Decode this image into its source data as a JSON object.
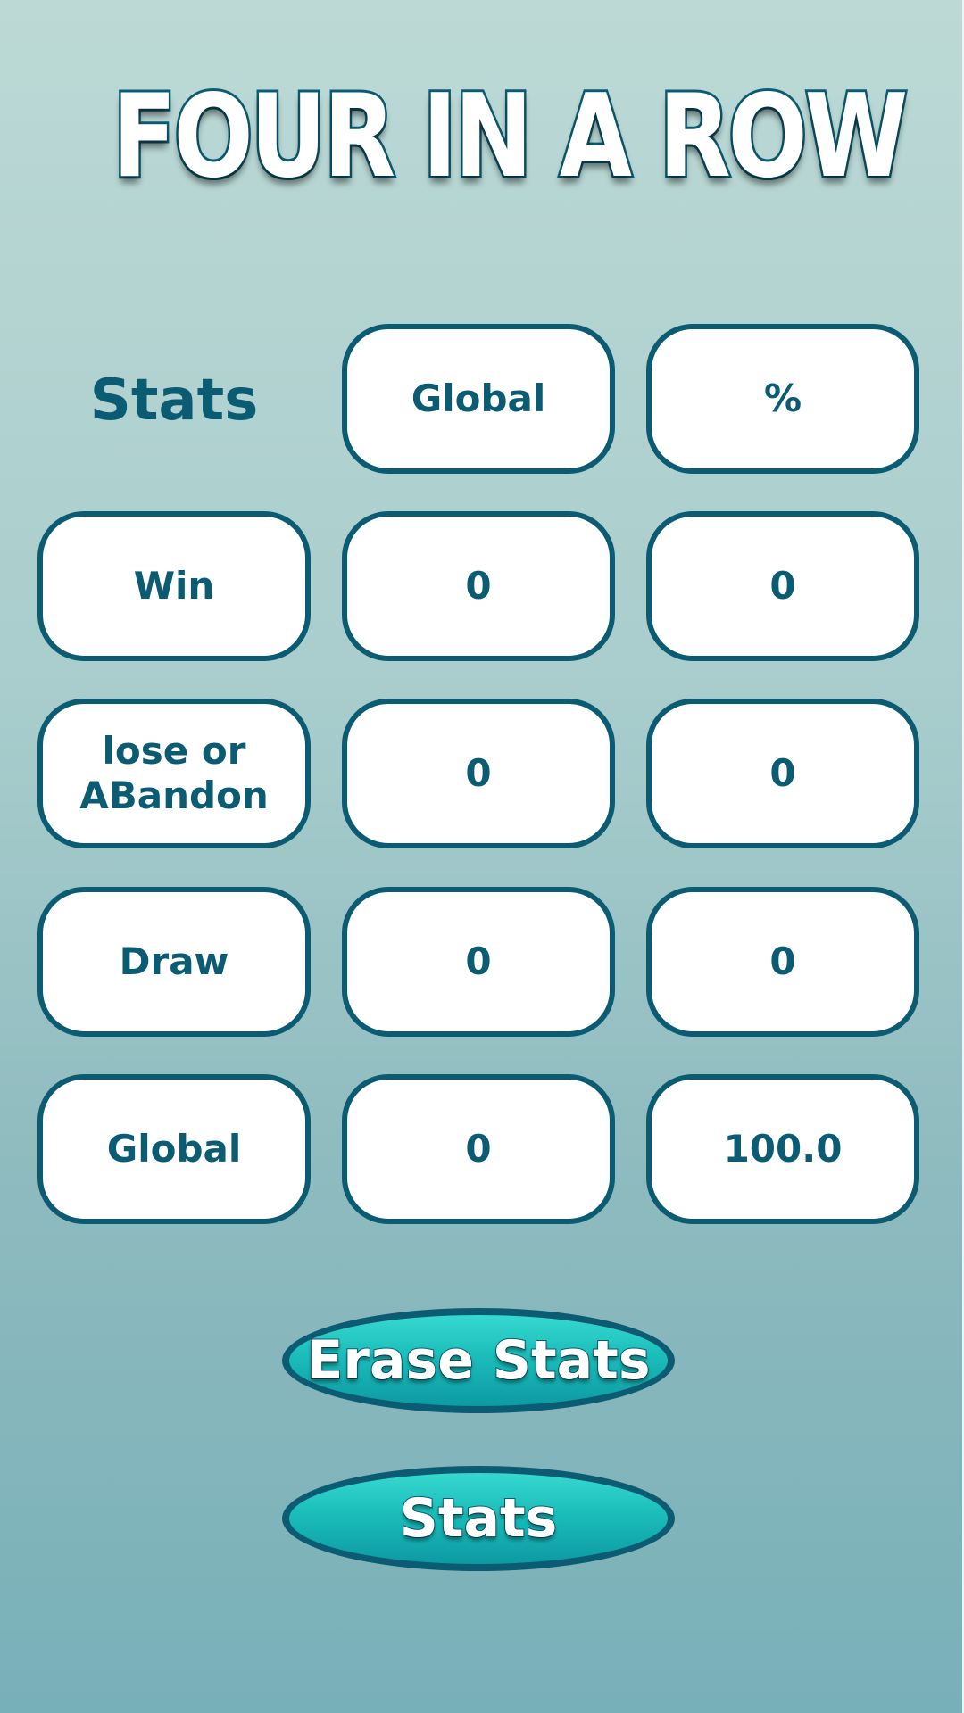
{
  "title": "FOUR IN A ROW",
  "table": {
    "heading": "Stats",
    "column_headers": [
      "Global",
      "%"
    ],
    "rows": [
      {
        "label": "Win",
        "global": "0",
        "percent": "0"
      },
      {
        "label": "lose or\nABandon",
        "global": "0",
        "percent": "0"
      },
      {
        "label": "Draw",
        "global": "0",
        "percent": "0"
      },
      {
        "label": "Global",
        "global": "0",
        "percent": "100.0"
      }
    ]
  },
  "buttons": {
    "erase_label": "Erase Stats",
    "stats_label": "Stats"
  },
  "colors": {
    "accent": "#0b5c73",
    "button": "#1bbdbb",
    "background_top": "#bcd9d5",
    "background_bottom": "#78b0b9"
  }
}
